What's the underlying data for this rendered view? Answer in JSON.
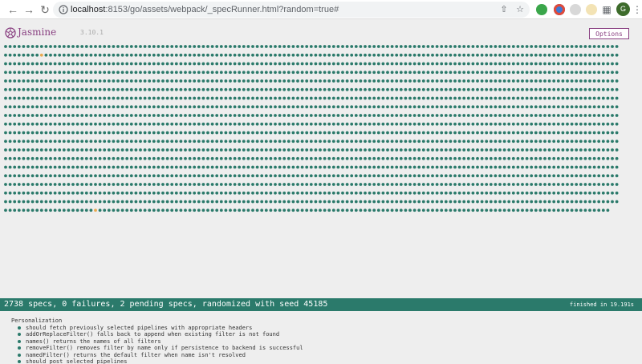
{
  "browser": {
    "url_host": "localhost",
    "url_path": ":8153/go/assets/webpack/_specRunner.html?random=true#",
    "avatar_letter": "G"
  },
  "jasmine": {
    "brand": "Jasmine",
    "version": "3.10.1",
    "options_label": "Options",
    "colors": {
      "passed": "#2b7a6b",
      "pending": "#e8a94f",
      "bar": "#2b7a6b",
      "brand": "#8a4182"
    },
    "dots": {
      "total_dots": 2738,
      "pending_indices": [
        145,
        2623
      ]
    },
    "summary": "2738 specs, 0 failures, 2 pending specs, randomized with seed 45185",
    "duration": "finished in 19.191s",
    "suite": "Personalization",
    "specs": [
      "should fetch previously selected pipelines with appropriate headers",
      "addOrReplaceFilter() falls back to append when existing filter is not found",
      "names() returns the names of all filters",
      "removeFilter() removes filter by name only if persistence to backend is successful",
      "namedFilter() returns the default filter when name isn't resolved",
      "should post selected pipelines"
    ]
  }
}
